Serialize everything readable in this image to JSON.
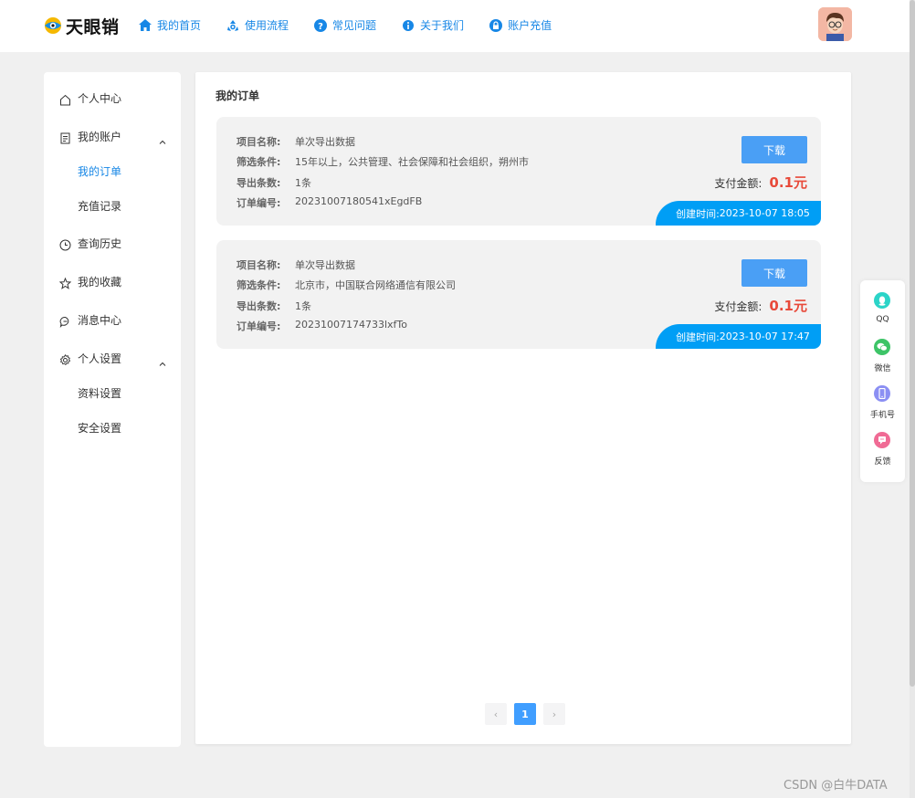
{
  "header": {
    "logo_text": "天眼销",
    "nav": [
      {
        "label": "我的首页",
        "icon": "home-icon"
      },
      {
        "label": "使用流程",
        "icon": "recycle-icon"
      },
      {
        "label": "常见问题",
        "icon": "question-icon"
      },
      {
        "label": "关于我们",
        "icon": "info-icon"
      },
      {
        "label": "账户充值",
        "icon": "lock-icon"
      }
    ]
  },
  "sidebar": {
    "items": [
      {
        "label": "个人中心",
        "icon": "home-outline-icon"
      },
      {
        "label": "我的账户",
        "icon": "document-icon",
        "sub": [
          "我的订单",
          "充值记录"
        ]
      },
      {
        "label": "查询历史",
        "icon": "clock-icon"
      },
      {
        "label": "我的收藏",
        "icon": "star-icon"
      },
      {
        "label": "消息中心",
        "icon": "chat-icon"
      },
      {
        "label": "个人设置",
        "icon": "gear-icon",
        "sub": [
          "资料设置",
          "安全设置"
        ]
      }
    ],
    "active": "我的订单"
  },
  "main": {
    "title": "我的订单",
    "labels": {
      "project": "项目名称:",
      "filter": "筛选条件:",
      "count": "导出条数:",
      "order_no": "订单编号:",
      "download": "下载",
      "pay": "支付金额:",
      "created_prefix": "创建时间:"
    },
    "orders": [
      {
        "project": "单次导出数据",
        "filter": "15年以上，公共管理、社会保障和社会组织，朔州市",
        "count": "1条",
        "order_no": "20231007180541xEgdFB",
        "amount": "0.1元",
        "created": "2023-10-07 18:05"
      },
      {
        "project": "单次导出数据",
        "filter": "北京市，中国联合网络通信有限公司",
        "count": "1条",
        "order_no": "20231007174733lxfTo",
        "amount": "0.1元",
        "created": "2023-10-07 17:47"
      }
    ],
    "pagination": {
      "current": "1",
      "prev": "‹",
      "next": "›"
    }
  },
  "float_tools": [
    {
      "label": "QQ",
      "icon": "qq-icon",
      "color": "#2bd4c8"
    },
    {
      "label": "微信",
      "icon": "wechat-icon",
      "color": "#3dc467"
    },
    {
      "label": "手机号",
      "icon": "phone-icon",
      "color": "#8b8ff3"
    },
    {
      "label": "反馈",
      "icon": "feedback-icon",
      "color": "#f06b95"
    }
  ],
  "watermark": "CSDN @白牛DATA",
  "colors": {
    "accent": "#1787e6",
    "button": "#4a9ff5",
    "price": "#e84a3a",
    "created_bg": "#009ef5"
  }
}
